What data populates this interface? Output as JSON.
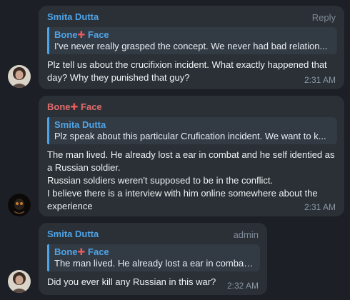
{
  "colors": {
    "background": "#1c2026",
    "bubble": "#2b3036",
    "sender_blue": "#4ea4e8",
    "sender_red": "#e06c6c",
    "plus_red": "#e75b5b",
    "meta_gray": "#8a96a3"
  },
  "messages": [
    {
      "sender": "Smita Dutta",
      "header_right": "Reply",
      "quote_sender": "Bone",
      "quote_sender_suffix": " Face",
      "quote_text": "I've never really grasped the concept. We never had  bad relation...",
      "body": "Plz tell us about the crucifixion incident. What exactly happened that day? Why they punished that guy?",
      "time": "2:31 AM"
    },
    {
      "sender": "Bone",
      "sender_suffix": " Face",
      "quote_sender": "Smita Dutta",
      "quote_text": "Plz speak about this particular Crufication incident. We want to k...",
      "body_lines": [
        "The man lived. He already lost a ear in combat and he self identied as a Russian soldier.",
        "Russian soldiers weren't supposed to be in the conflict.",
        "I believe there is a interview with him online somewhere about the experience"
      ],
      "time": "2:31 AM"
    },
    {
      "sender": "Smita Dutta",
      "header_right": "admin",
      "quote_sender": "Bone",
      "quote_sender_suffix": " Face",
      "quote_text": "The man lived. He already lost a ear in combat ...",
      "body": "Did you ever kill any Russian in this war?",
      "time": "2:32 AM"
    }
  ],
  "plus_glyph": "✚"
}
